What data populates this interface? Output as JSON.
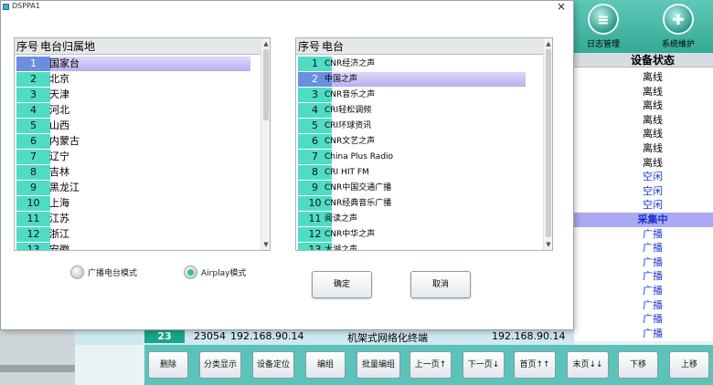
{
  "dialog": {
    "title": "DSPPA1",
    "close_glyph": "×",
    "province_list": {
      "header_num": "序号",
      "header_name": "电台归属地",
      "selected_index": 0,
      "rows": [
        {
          "num": "1",
          "name": "国家台"
        },
        {
          "num": "2",
          "name": "北京"
        },
        {
          "num": "3",
          "name": "天津"
        },
        {
          "num": "4",
          "name": "河北"
        },
        {
          "num": "5",
          "name": "山西"
        },
        {
          "num": "6",
          "name": "内蒙古"
        },
        {
          "num": "7",
          "name": "辽宁"
        },
        {
          "num": "8",
          "name": "吉林"
        },
        {
          "num": "9",
          "name": "黑龙江"
        },
        {
          "num": "10",
          "name": "上海"
        },
        {
          "num": "11",
          "name": "江苏"
        },
        {
          "num": "12",
          "name": "浙江"
        },
        {
          "num": "13",
          "name": "安徽"
        }
      ]
    },
    "station_list": {
      "header_num": "序号",
      "header_name": "电台",
      "selected_index": 1,
      "rows": [
        {
          "num": "1",
          "name": "CNR经济之声"
        },
        {
          "num": "2",
          "name": "中国之声"
        },
        {
          "num": "3",
          "name": "CNR音乐之声"
        },
        {
          "num": "4",
          "name": "CRI轻松调频"
        },
        {
          "num": "5",
          "name": "CRI环球资讯"
        },
        {
          "num": "6",
          "name": "CNR文艺之声"
        },
        {
          "num": "7",
          "name": "China Plus Radio"
        },
        {
          "num": "8",
          "name": "CRI HIT FM"
        },
        {
          "num": "9",
          "name": "CNR中国交通广播"
        },
        {
          "num": "10",
          "name": "CNR经典音乐广播"
        },
        {
          "num": "11",
          "name": "阅读之声"
        },
        {
          "num": "12",
          "name": "CNR中华之声"
        },
        {
          "num": "13",
          "name": "太湖之声"
        }
      ]
    },
    "modes": {
      "broadcast_label": "广播电台模式",
      "airplay_label": "Airplay模式",
      "selected": "airplay"
    },
    "confirm_label": "确定",
    "cancel_label": "取消"
  },
  "background": {
    "top_buttons": {
      "log_label": "日志管理",
      "maintenance_label": "系统维护"
    },
    "status_column": {
      "header": "设备状态",
      "cells": [
        {
          "text": "离线",
          "kind": "offline"
        },
        {
          "text": "离线",
          "kind": "offline"
        },
        {
          "text": "离线",
          "kind": "offline"
        },
        {
          "text": "离线",
          "kind": "offline"
        },
        {
          "text": "离线",
          "kind": "offline"
        },
        {
          "text": "离线",
          "kind": "offline"
        },
        {
          "text": "离线",
          "kind": "offline"
        },
        {
          "text": "空闲",
          "kind": "idle"
        },
        {
          "text": "空闲",
          "kind": "idle"
        },
        {
          "text": "空闲",
          "kind": "idle"
        },
        {
          "text": "采集中",
          "kind": "collect"
        },
        {
          "text": "广播",
          "kind": "broadcast"
        },
        {
          "text": "广播",
          "kind": "broadcast"
        },
        {
          "text": "广播",
          "kind": "broadcast"
        },
        {
          "text": "广播",
          "kind": "broadcast"
        },
        {
          "text": "广播",
          "kind": "broadcast"
        },
        {
          "text": "广播",
          "kind": "broadcast"
        },
        {
          "text": "广播",
          "kind": "broadcast"
        },
        {
          "text": "广播",
          "kind": "broadcast"
        }
      ]
    },
    "row_23": {
      "num": "23",
      "id": "23054",
      "ip": "192.168.90.14",
      "type": "机架式网络化终端",
      "ip2": "192.168.90.14"
    },
    "bottom_buttons": [
      {
        "label": "删除"
      },
      {
        "label": "分类显示"
      },
      {
        "label": "设备定位"
      },
      {
        "label": "编组"
      },
      {
        "label": "批量编组"
      },
      {
        "label": "上一页↑"
      },
      {
        "label": "下一页↓"
      },
      {
        "label": "首页↑↑"
      },
      {
        "label": "末页↓↓"
      },
      {
        "label": "下移"
      },
      {
        "label": "上移"
      }
    ]
  }
}
